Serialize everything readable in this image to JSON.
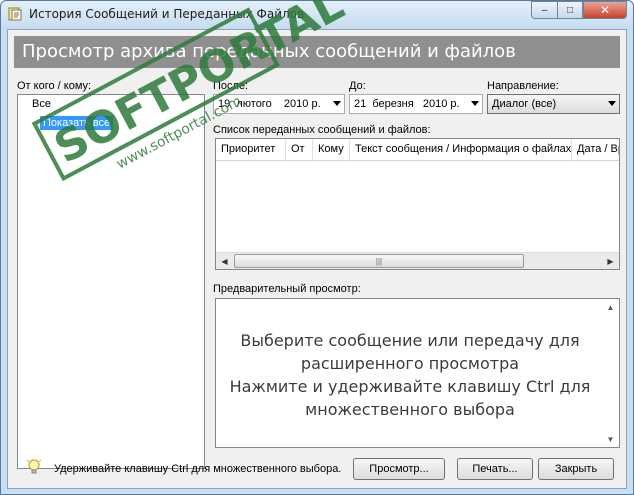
{
  "window": {
    "title": "История Сообщений и Переданных Файлов",
    "buttons": {
      "minimize": "–",
      "maximize": "□",
      "close": "✕"
    }
  },
  "banner": {
    "text": "Просмотр архива переданных сообщений и файлов"
  },
  "contacts": {
    "label": "От кого / кому:",
    "items": [
      {
        "label": "Все",
        "selected": false
      },
      {
        "label": "Показать все",
        "selected": true
      }
    ]
  },
  "filters": {
    "after_label": "После:",
    "after_value": "19  лютого    2010 р.",
    "before_label": "До:",
    "before_value": "21  березня   2010 р.",
    "direction_label": "Направление:",
    "direction_value": "Диалог (все)"
  },
  "messages": {
    "label": "Список переданных сообщений и файлов:",
    "columns": [
      "Приоритет",
      "От",
      "Кому",
      "Текст сообщения / Информация о файлах",
      "Дата / Вр"
    ]
  },
  "preview": {
    "label": "Предварительный просмотр:",
    "line1": "Выберите сообщение или передачу для",
    "line2": "расширенного просмотра",
    "line3": "Нажмите и удерживайте клавишу Ctrl для",
    "line4": "множественного выбора"
  },
  "footer": {
    "hint": "Удерживайте клавишу Ctrl для множественного выбора.",
    "view_button": "Просмотр...",
    "print_button": "Печать...",
    "close_button": "Закрыть"
  },
  "watermark": {
    "brand": "SOFTPORTAL",
    "tm": "™",
    "url": "www.softportal.com"
  },
  "colors": {
    "banner": "#8f8f8f",
    "selection": "#3399ff",
    "watermark": "#2f7a3a"
  }
}
